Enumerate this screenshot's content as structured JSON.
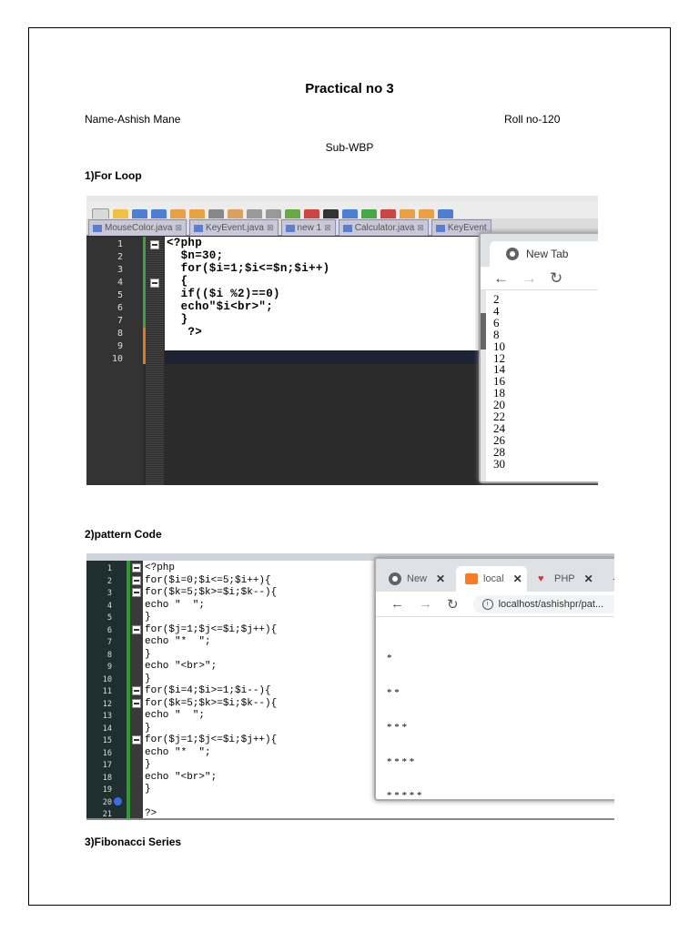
{
  "doc": {
    "title": "Practical no 3",
    "name": "Name-Ashish Mane",
    "roll": "Roll no-120",
    "subject": "Sub-WBP",
    "section1": "1)For Loop",
    "section2": "2)pattern  Code",
    "section3": "3)Fibonacci Series"
  },
  "shot1": {
    "editor_tabs": [
      "MouseColor.java",
      "KeyEvent.java",
      "new 1",
      "Calculator.java",
      "KeyEvent"
    ],
    "line_numbers": [
      "1",
      "2",
      "3",
      "4",
      "5",
      "6",
      "7",
      "8",
      "9",
      "10"
    ],
    "code": [
      "<?php",
      "  $n=30;",
      "  for($i=1;$i<=$n;$i++)",
      "  {",
      "  if(($i %2)==0)",
      "  echo\"$i<br>\";",
      "  }",
      "   ?>"
    ],
    "browser_tab": "New Tab",
    "output": [
      "2",
      "4",
      "6",
      "8",
      "10",
      "12",
      "14",
      "16",
      "18",
      "20",
      "22",
      "24",
      "26",
      "28",
      "30"
    ]
  },
  "shot2": {
    "line_numbers": [
      "1",
      "2",
      "3",
      "4",
      "5",
      "6",
      "7",
      "8",
      "9",
      "10",
      "11",
      "12",
      "13",
      "14",
      "15",
      "16",
      "17",
      "18",
      "19",
      "20",
      "21"
    ],
    "code": [
      "<?php",
      "for($i=0;$i<=5;$i++){",
      "for($k=5;$k>=$i;$k--){",
      "echo \"  \";",
      "}",
      "for($j=1;$j<=$i;$j++){",
      "echo \"*  \";",
      "}",
      "echo \"<br>\";",
      "}",
      "for($i=4;$i>=1;$i--){",
      "for($k=5;$k>=$i;$k--){",
      "echo \"  \";",
      "}",
      "for($j=1;$j<=$i;$j++){",
      "echo \"*  \";",
      "}",
      "echo \"<br>\";",
      "}",
      "",
      "?>"
    ],
    "tabs": [
      "New",
      "local",
      "PHP"
    ],
    "url": "localhost/ashishpr/pat...",
    "pattern": [
      "*",
      "* *",
      "* * *",
      "* * * *",
      "* * * * *",
      "* * * *",
      "* * *",
      "* *",
      "*"
    ]
  }
}
